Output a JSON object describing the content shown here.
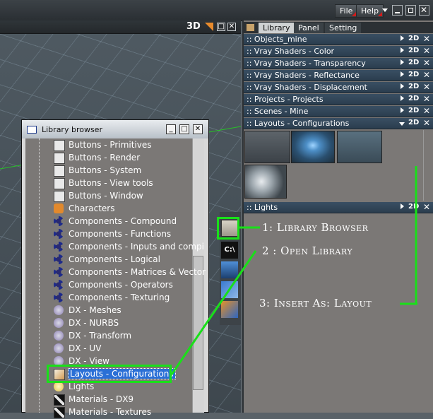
{
  "menu": {
    "file": "File",
    "help": "Help"
  },
  "viewport": {
    "label": "3D"
  },
  "panel": {
    "tabs": [
      "Library",
      "Panel",
      "Setting"
    ],
    "rows": [
      {
        "label": ":: Objects_mine",
        "mode": "2D"
      },
      {
        "label": ":: Vray Shaders - Color",
        "mode": "2D"
      },
      {
        "label": ":: Vray Shaders - Transparency",
        "mode": "2D"
      },
      {
        "label": ":: Vray Shaders - Reflectance",
        "mode": "2D"
      },
      {
        "label": ":: Vray Shaders - Displacement",
        "mode": "2D"
      },
      {
        "label": ":: Projects - Projects",
        "mode": "2D"
      },
      {
        "label": ":: Scenes - Mine",
        "mode": "2D"
      },
      {
        "label": ":: Layouts - Configurations",
        "mode": "2D"
      }
    ],
    "lights_row": {
      "label": ":: Lights",
      "mode": "2D"
    }
  },
  "browser": {
    "title": "Library browser",
    "items": [
      {
        "label": "Buttons - Primitives",
        "icon": "button-icon"
      },
      {
        "label": "Buttons - Render",
        "icon": "button-icon"
      },
      {
        "label": "Buttons - System",
        "icon": "button-icon"
      },
      {
        "label": "Buttons - View tools",
        "icon": "button-icon"
      },
      {
        "label": "Buttons - Window",
        "icon": "button-icon"
      },
      {
        "label": "Characters",
        "icon": "character-icon"
      },
      {
        "label": "Components - Compound",
        "icon": "component-icon"
      },
      {
        "label": "Components - Functions",
        "icon": "component-icon"
      },
      {
        "label": "Components - Inputs and compi",
        "icon": "component-icon"
      },
      {
        "label": "Components - Logical",
        "icon": "component-icon"
      },
      {
        "label": "Components - Matrices & Vector",
        "icon": "component-icon"
      },
      {
        "label": "Components - Operators",
        "icon": "component-icon"
      },
      {
        "label": "Components - Texturing",
        "icon": "component-icon"
      },
      {
        "label": "DX - Meshes",
        "icon": "dx-icon"
      },
      {
        "label": "DX - NURBS",
        "icon": "dx-icon"
      },
      {
        "label": "DX - Transform",
        "icon": "dx-icon"
      },
      {
        "label": "DX - UV",
        "icon": "dx-icon"
      },
      {
        "label": "DX - View",
        "icon": "dx-icon"
      },
      {
        "label": "Layouts - Configurations",
        "icon": "layout-icon",
        "selected": true
      },
      {
        "label": "Lights",
        "icon": "light-icon"
      },
      {
        "label": "Materials - DX9",
        "icon": "material-icon"
      },
      {
        "label": "Materials - Textures",
        "icon": "material-icon"
      }
    ]
  },
  "annotations": {
    "step1": "1: Library Browser",
    "step2": "2 : Open Library",
    "step3": "3: Insert As: Layout"
  },
  "colors": {
    "annotation_green": "#19e019",
    "row_blue": "#2f4356",
    "selection_blue": "#2a6fd6"
  }
}
